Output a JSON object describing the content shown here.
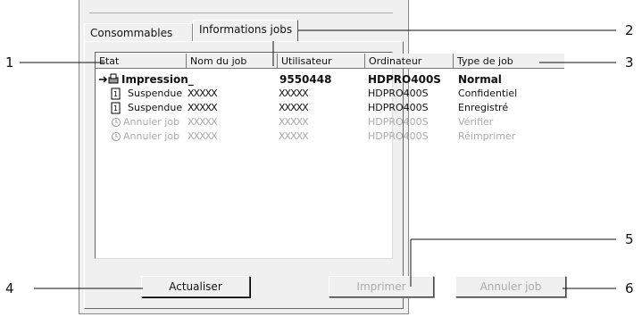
{
  "tabs": [
    {
      "label": "Consommables",
      "active": false
    },
    {
      "label": "Informations jobs",
      "active": true
    }
  ],
  "columns": [
    "Etat",
    "Nom du job",
    "Utilisateur",
    "Ordinateur",
    "Type de job"
  ],
  "rows": [
    {
      "status": "Impression_",
      "job": "",
      "user": "9550448",
      "computer": "HDPRO400S",
      "type": "Normal",
      "style": "bold",
      "icon": "printing-arrow-icon"
    },
    {
      "status": "Suspendue",
      "job": "XXXXX",
      "user": "XXXXX",
      "computer": "HDPRO400S",
      "type": "Confidentiel",
      "style": "normal",
      "icon": "page-icon"
    },
    {
      "status": "Suspendue",
      "job": "XXXXX",
      "user": "XXXXX",
      "computer": "HDPRO400S",
      "type": "Enregistré",
      "style": "normal",
      "icon": "page-icon"
    },
    {
      "status": "Annuler job",
      "job": "XXXXX",
      "user": "XXXXX",
      "computer": "HDPRO400S",
      "type": "Vérifier",
      "style": "dim",
      "icon": "clock-icon"
    },
    {
      "status": "Annuler job",
      "job": "XXXXX",
      "user": "XXXXX",
      "computer": "HDPRO400S",
      "type": "Réimprimer",
      "style": "dim",
      "icon": "clock-icon"
    }
  ],
  "buttons": {
    "refresh": "Actualiser",
    "print": "Imprimer",
    "cancel": "Annuler job"
  },
  "callouts": [
    "1",
    "2",
    "3",
    "4",
    "5",
    "6"
  ]
}
